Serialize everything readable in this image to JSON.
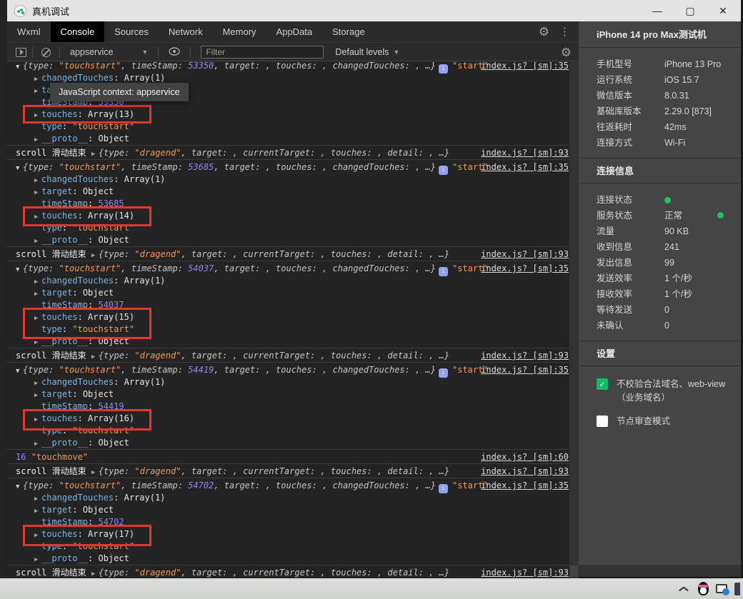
{
  "window": {
    "title": "真机调试",
    "controls": {
      "minimize": "—",
      "maximize": "▢",
      "close": "✕"
    }
  },
  "tabs": {
    "items": [
      "Wxml",
      "Console",
      "Sources",
      "Network",
      "Memory",
      "AppData",
      "Storage"
    ],
    "active": "Console"
  },
  "toolbar": {
    "context": "appservice",
    "filter_placeholder": "Filter",
    "levels": "Default levels"
  },
  "tooltip": "JavaScript context: appservice",
  "console": {
    "prompt": ">",
    "strings": {
      "scroll_label": "scroll 滑动结束",
      "dragend_pre": "{type: ",
      "dragend_str": "\"dragend\"",
      "dragend_post": ", target: , currentTarget: , touches: , detail: , …}",
      "touchstart_pre": "{type: ",
      "touchstart_str": "\"touchstart\"",
      "preview_mid": ", timeStamp: ",
      "preview_post": ", target: , touches: , changedTouches: , …}",
      "start_tag": "\"start\"",
      "badge_glyph": "i",
      "link_touchstart": "index.js? [sm]:35",
      "link_dragend": "index.js? [sm]:93",
      "link_touchmove": "index.js? [sm]:60"
    },
    "child_template": [
      {
        "key": "changedTouches",
        "value": "Array(1)",
        "arrow": true,
        "vclass": "plain"
      },
      {
        "key": "target",
        "value": "Object",
        "arrow": true,
        "vclass": "plain"
      },
      {
        "key": "timeStamp",
        "value": "",
        "arrow": false,
        "vclass": "num"
      },
      {
        "key": "touches",
        "value": "",
        "arrow": true,
        "vclass": "plain"
      },
      {
        "key": "type",
        "value": "\"touchstart\"",
        "arrow": false,
        "vclass": "str"
      },
      {
        "key": "__proto__",
        "value": "Object",
        "arrow": true,
        "vclass": "plain"
      }
    ],
    "entries": [
      {
        "type": "group",
        "timeStamp": "53350",
        "touches": "Array(13)",
        "clip": true,
        "redbox_h": 26
      },
      {
        "type": "scroll"
      },
      {
        "type": "group",
        "timeStamp": "53685",
        "touches": "Array(14)",
        "redbox_h": 28
      },
      {
        "type": "scroll"
      },
      {
        "type": "group",
        "timeStamp": "54037",
        "touches": "Array(15)",
        "redbox_h": 44
      },
      {
        "type": "scroll"
      },
      {
        "type": "group",
        "timeStamp": "54419",
        "touches": "Array(16)",
        "redbox_h": 30
      },
      {
        "type": "count",
        "count": "16",
        "label": "\"touchmove\""
      },
      {
        "type": "scroll"
      },
      {
        "type": "group",
        "timeStamp": "54702",
        "touches": "Array(17)",
        "redbox_h": 30
      },
      {
        "type": "scroll"
      },
      {
        "type": "prompt"
      }
    ]
  },
  "sidebar": {
    "device_title": "iPhone 14 pro Max测试机",
    "device_info": [
      {
        "label": "手机型号",
        "value": "iPhone 13 Pro"
      },
      {
        "label": "运行系统",
        "value": "iOS 15.7"
      },
      {
        "label": "微信版本",
        "value": "8.0.31"
      },
      {
        "label": "基础库版本",
        "value": "2.29.0 [873]"
      },
      {
        "label": "往返耗时",
        "value": "42ms"
      },
      {
        "label": "连接方式",
        "value": "Wi-Fi"
      }
    ],
    "conn_title": "连接信息",
    "conn_info": [
      {
        "label": "连接状态",
        "value": "",
        "dot": true
      },
      {
        "label": "服务状态",
        "value": "正常",
        "right_dot": true
      },
      {
        "label": "流量",
        "value": "90 KB"
      },
      {
        "label": "收到信息",
        "value": "241"
      },
      {
        "label": "发出信息",
        "value": "99"
      },
      {
        "label": "发送效率",
        "value": "1 个/秒"
      },
      {
        "label": "接收效率",
        "value": "1 个/秒"
      },
      {
        "label": "等待发送",
        "value": "0"
      },
      {
        "label": "未确认",
        "value": "0"
      }
    ],
    "settings_title": "设置",
    "settings": [
      {
        "label": "不校验合法域名、web-view（业务域名）",
        "checked": true
      },
      {
        "label": "节点审查模式",
        "checked": false
      }
    ],
    "colors": {
      "green": "#07c160",
      "status_dot": "#21c25e",
      "annotation_red": "#e0382c"
    }
  }
}
